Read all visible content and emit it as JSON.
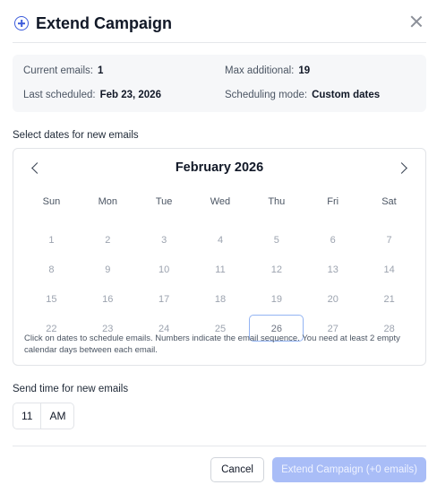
{
  "header": {
    "title": "Extend Campaign",
    "icon": "plus-circle-icon",
    "close_icon": "close-icon"
  },
  "summary": {
    "current_emails_label": "Current emails:",
    "current_emails_value": "1",
    "max_additional_label": "Max additional:",
    "max_additional_value": "19",
    "last_scheduled_label": "Last scheduled:",
    "last_scheduled_value": "Feb 23, 2026",
    "scheduling_mode_label": "Scheduling mode:",
    "scheduling_mode_value": "Custom dates"
  },
  "dates_section": {
    "label": "Select dates for new emails"
  },
  "calendar": {
    "month": "February 2026",
    "weekdays": [
      "Sun",
      "Mon",
      "Tue",
      "Wed",
      "Thu",
      "Fri",
      "Sat"
    ],
    "weeks": [
      [
        "1",
        "2",
        "3",
        "4",
        "5",
        "6",
        "7"
      ],
      [
        "8",
        "9",
        "10",
        "11",
        "12",
        "13",
        "14"
      ],
      [
        "15",
        "16",
        "17",
        "18",
        "19",
        "20",
        "21"
      ],
      [
        "22",
        "23",
        "24",
        "25",
        "26",
        "27",
        "28"
      ]
    ],
    "highlighted_day": "26",
    "hint": "Click on dates to schedule emails. Numbers indicate the email sequence. You need at least 2 empty calendar days between each email."
  },
  "time_section": {
    "label": "Send time for new emails",
    "hour": "11",
    "period": "AM"
  },
  "footer": {
    "cancel_label": "Cancel",
    "submit_label": "Extend Campaign (+0 emails)"
  },
  "colors": {
    "accent": "#3b5bdb",
    "primary_disabled": "#a9bdf7",
    "today_border": "#93b4f3"
  }
}
